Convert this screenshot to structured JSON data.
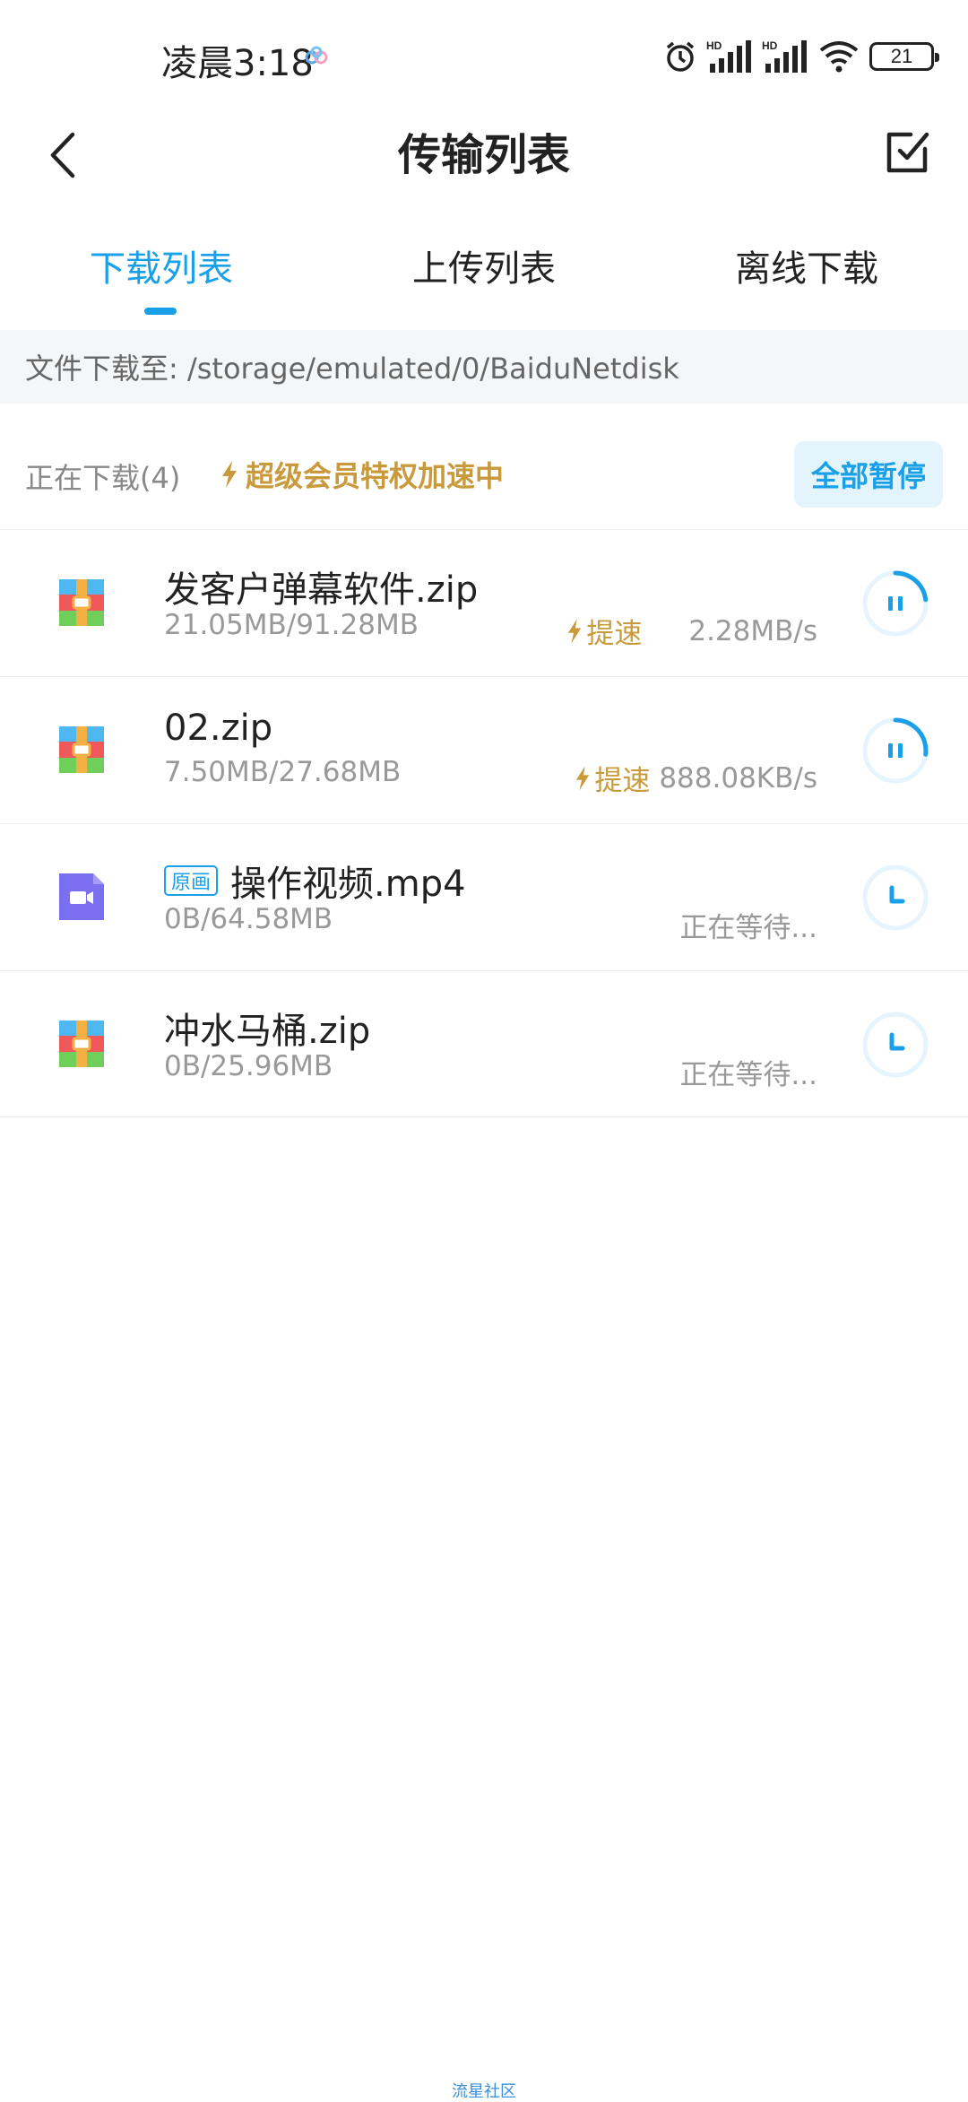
{
  "status_bar": {
    "time": "凌晨3:18",
    "battery": "21"
  },
  "header": {
    "title": "传输列表"
  },
  "tabs": [
    {
      "label": "下载列表",
      "active": true
    },
    {
      "label": "上传列表",
      "active": false
    },
    {
      "label": "离线下载",
      "active": false
    }
  ],
  "path": {
    "text": "文件下载至: /storage/emulated/0/BaiduNetdisk"
  },
  "summary": {
    "count_text": "正在下载(4)",
    "boost_text": "超级会员特权加速中",
    "pause_all_label": "全部暂停"
  },
  "items": [
    {
      "name": "发客户弹幕软件.zip",
      "size": "21.05MB/91.28MB",
      "boost_label": "提速",
      "speed": "2.28MB/s",
      "type": "zip",
      "status": "downloading",
      "progress": 0.23
    },
    {
      "name": "02.zip",
      "size": "7.50MB/27.68MB",
      "boost_label": "提速",
      "speed": "888.08KB/s",
      "type": "zip",
      "status": "downloading",
      "progress": 0.27
    },
    {
      "name": "操作视频.mp4",
      "badge": "原画",
      "size": "0B/64.58MB",
      "speed": "正在等待...",
      "type": "video",
      "status": "waiting"
    },
    {
      "name": "冲水马桶.zip",
      "size": "0B/25.96MB",
      "speed": "正在等待...",
      "type": "zip",
      "status": "waiting"
    }
  ],
  "watermark": "流星社区",
  "colors": {
    "accent": "#1aa0e8",
    "gold": "#c99a3c",
    "video": "#7a6ff0"
  }
}
